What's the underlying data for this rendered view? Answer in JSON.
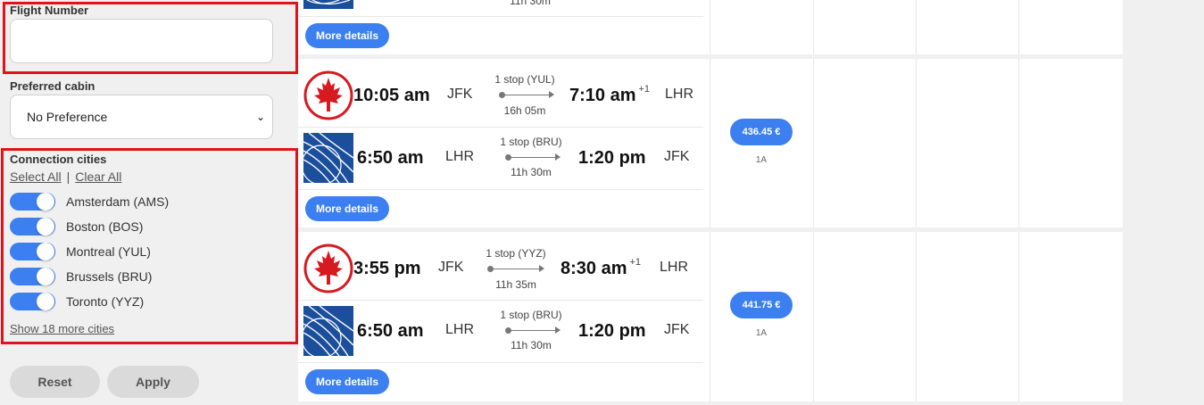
{
  "sidebar": {
    "flight_number_label": "Flight Number",
    "flight_number_value": "",
    "cabin_label": "Preferred cabin",
    "cabin_value": "No Preference",
    "connection_label": "Connection cities",
    "select_all": "Select All",
    "separator": "|",
    "clear_all": "Clear All",
    "cities": [
      {
        "name": "Amsterdam (AMS)",
        "on": true
      },
      {
        "name": "Boston (BOS)",
        "on": true
      },
      {
        "name": "Montreal (YUL)",
        "on": true
      },
      {
        "name": "Brussels (BRU)",
        "on": true
      },
      {
        "name": "Toronto (YYZ)",
        "on": true
      }
    ],
    "show_more": "Show 18 more cities",
    "reset": "Reset",
    "apply": "Apply"
  },
  "highlight_color": "#e0131a",
  "accent_color": "#3b7ff0",
  "results": [
    {
      "partial": true,
      "partial_duration": "11h 30m",
      "more_details": "More details"
    },
    {
      "outbound": {
        "airline_icon": "air-canada-logo",
        "dep_time": "10:05 am",
        "dep_code": "JFK",
        "stops": "1 stop (YUL)",
        "duration": "16h 05m",
        "arr_time": "7:10 am",
        "arr_plus": "+1",
        "arr_code": "LHR"
      },
      "inbound": {
        "airline_icon": "united-logo",
        "dep_time": "6:50 am",
        "dep_code": "LHR",
        "stops": "1 stop (BRU)",
        "duration": "11h 30m",
        "arr_time": "1:20 pm",
        "arr_plus": "",
        "arr_code": "JFK"
      },
      "more_details": "More details",
      "price": "436.45 €",
      "fare_class": "1A"
    },
    {
      "outbound": {
        "airline_icon": "air-canada-logo",
        "dep_time": "3:55 pm",
        "dep_code": "JFK",
        "stops": "1 stop (YYZ)",
        "duration": "11h 35m",
        "arr_time": "8:30 am",
        "arr_plus": "+1",
        "arr_code": "LHR"
      },
      "inbound": {
        "airline_icon": "united-logo",
        "dep_time": "6:50 am",
        "dep_code": "LHR",
        "stops": "1 stop (BRU)",
        "duration": "11h 30m",
        "arr_time": "1:20 pm",
        "arr_plus": "",
        "arr_code": "JFK"
      },
      "more_details": "More details",
      "price": "441.75 €",
      "fare_class": "1A"
    }
  ]
}
